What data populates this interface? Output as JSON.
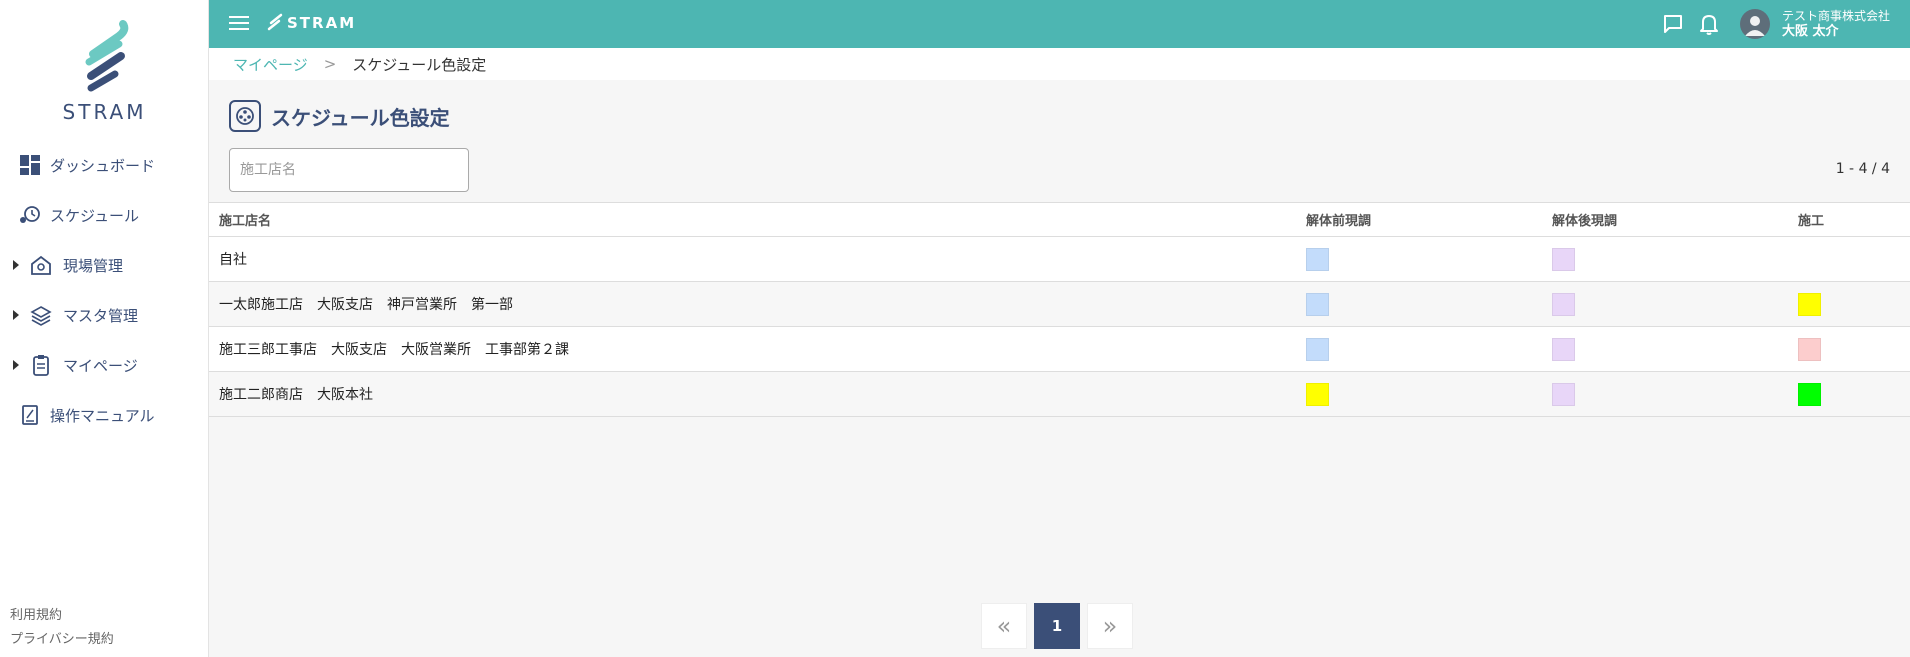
{
  "app": {
    "name": "STRAM"
  },
  "header": {
    "company": "テスト商事株式会社",
    "user_name": "大阪 太介"
  },
  "sidebar": {
    "items": [
      {
        "label": "ダッシュボード",
        "icon": "dashboard-icon",
        "expandable": false
      },
      {
        "label": "スケジュール",
        "icon": "schedule-icon",
        "expandable": false
      },
      {
        "label": "現場管理",
        "icon": "site-icon",
        "expandable": true
      },
      {
        "label": "マスタ管理",
        "icon": "layers-icon",
        "expandable": true
      },
      {
        "label": "マイページ",
        "icon": "clipboard-icon",
        "expandable": true
      },
      {
        "label": "操作マニュアル",
        "icon": "manual-icon",
        "expandable": false
      }
    ],
    "footer": [
      "利用規約",
      "プライバシー規約"
    ]
  },
  "breadcrumb": {
    "parent": "マイページ",
    "separator": ">",
    "current": "スケジュール色設定"
  },
  "page": {
    "title": "スケジュール色設定",
    "search_placeholder": "施工店名",
    "count": "1 - 4 / 4"
  },
  "table": {
    "columns": [
      "施工店名",
      "解体前現調",
      "解体後現調",
      "施工"
    ],
    "rows": [
      {
        "name": "自社",
        "before": "#c3dcfb",
        "after": "#e8d6f8",
        "work": ""
      },
      {
        "name": "一太郎施工店　大阪支店　神戸営業所　第一部",
        "before": "#c3dcfb",
        "after": "#e8d6f8",
        "work": "#ffff00"
      },
      {
        "name": "施工三郎工事店　大阪支店　大阪営業所　工事部第２課",
        "before": "#c3dcfb",
        "after": "#e8d6f8",
        "work": "#fccdcd"
      },
      {
        "name": "施工二郎商店　大阪本社",
        "before": "#ffff00",
        "after": "#e8d6f8",
        "work": "#00ff00"
      }
    ]
  },
  "pagination": {
    "prev": "«",
    "current": "1",
    "next": "»"
  },
  "colors": {
    "header": "#4db6b2",
    "brand_navy": "#3b4f78"
  }
}
